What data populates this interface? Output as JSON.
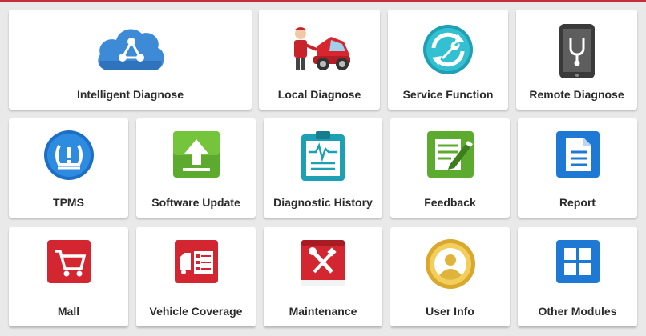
{
  "accent_color": "#c62e38",
  "tiles_row1": [
    {
      "label": "Intelligent Diagnose",
      "icon": "cloud-share-icon"
    },
    {
      "label": "Local Diagnose",
      "icon": "mechanic-car-icon"
    },
    {
      "label": "Service Function",
      "icon": "wrench-refresh-icon"
    },
    {
      "label": "Remote Diagnose",
      "icon": "tablet-stethoscope-icon"
    }
  ],
  "tiles_row2": [
    {
      "label": "TPMS",
      "icon": "tire-pressure-icon"
    },
    {
      "label": "Software Update",
      "icon": "upload-arrow-icon"
    },
    {
      "label": "Diagnostic History",
      "icon": "clipboard-waveform-icon"
    },
    {
      "label": "Feedback",
      "icon": "notepad-pencil-icon"
    },
    {
      "label": "Report",
      "icon": "document-icon"
    }
  ],
  "tiles_row3": [
    {
      "label": "Mall",
      "icon": "shopping-cart-icon"
    },
    {
      "label": "Vehicle Coverage",
      "icon": "vehicle-list-icon"
    },
    {
      "label": "Maintenance",
      "icon": "tools-book-icon"
    },
    {
      "label": "User Info",
      "icon": "user-avatar-icon"
    },
    {
      "label": "Other Modules",
      "icon": "grid-modules-icon"
    }
  ]
}
